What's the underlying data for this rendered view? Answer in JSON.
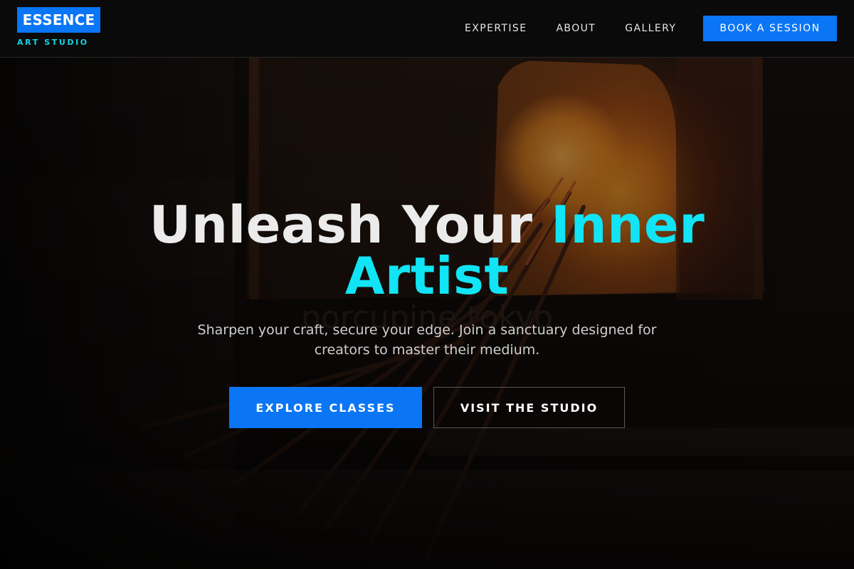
{
  "brand": {
    "name": "ESSENCE",
    "tagline": "ART STUDIO",
    "colors": {
      "primary": "#0a75f5",
      "accent": "#11e4f4",
      "background": "#0a0a0a"
    }
  },
  "nav": {
    "links": [
      {
        "label": "EXPERTISE"
      },
      {
        "label": "ABOUT"
      },
      {
        "label": "GALLERY"
      }
    ],
    "cta_label": "BOOK A SESSION"
  },
  "hero": {
    "headline_part1": "Unleash Your",
    "headline_accent1": "Inner",
    "headline_accent2": "Artist",
    "subtitle": "Sharpen your craft, secure your edge. Join a sanctuary designed for creators to master their medium.",
    "primary_button": "EXPLORE CLASSES",
    "secondary_button": "VISIT THE STUDIO",
    "background_watermark": "porcupine tokyo"
  }
}
